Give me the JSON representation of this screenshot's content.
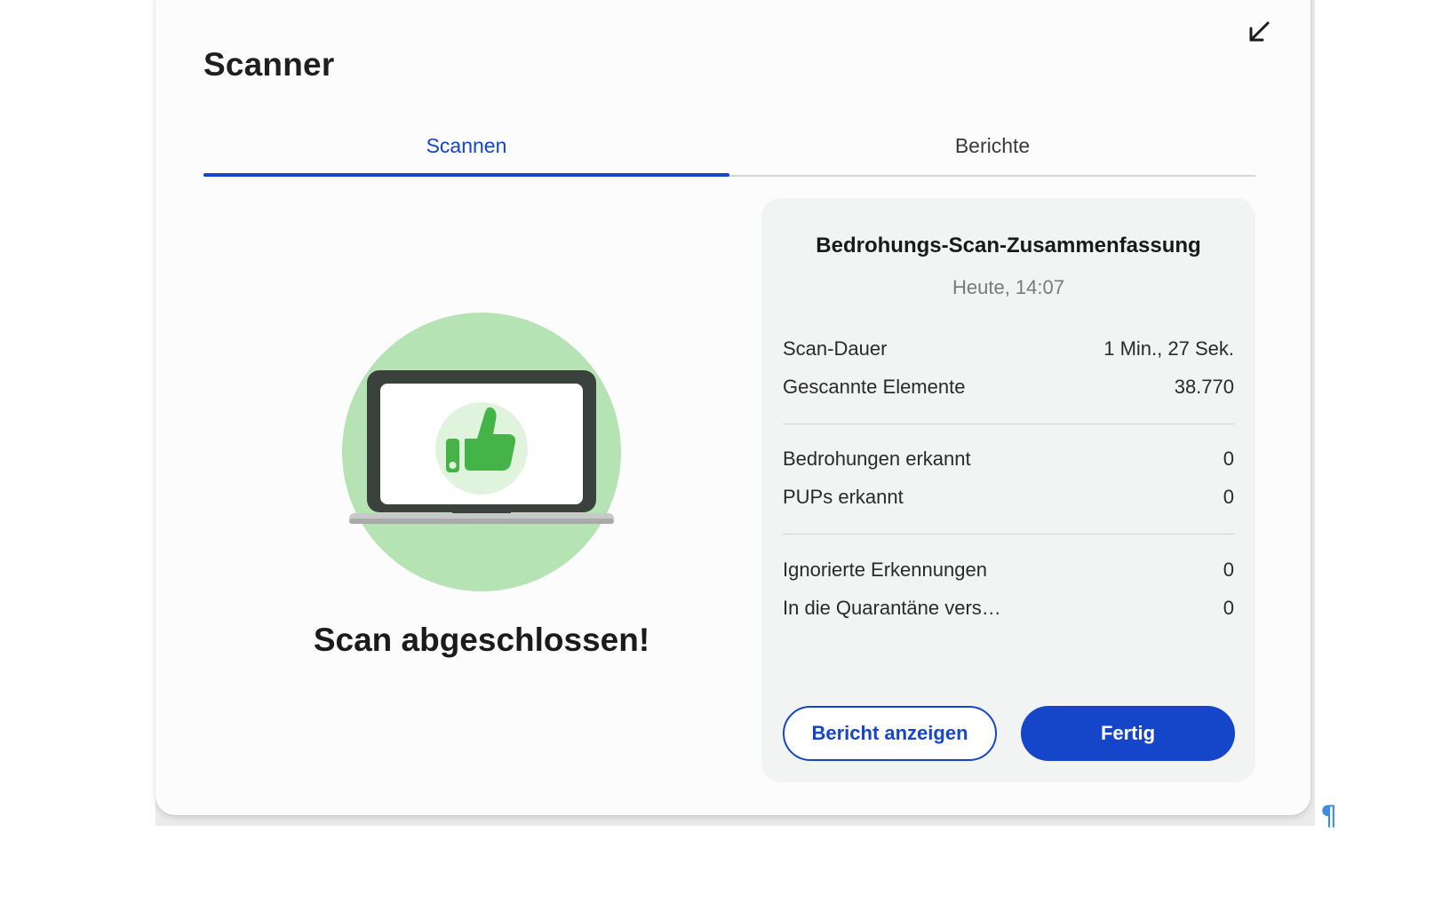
{
  "window": {
    "title": "Scanner",
    "minimize_icon": "arrow-down-left-icon"
  },
  "tabs": [
    {
      "label": "Scannen",
      "active": true
    },
    {
      "label": "Berichte",
      "active": false
    }
  ],
  "status": {
    "illustration": "laptop-thumbs-up-icon",
    "message": "Scan abgeschlossen!"
  },
  "summary": {
    "title": "Bedrohungs-Scan-Zusammenfassung",
    "date": "Heute, 14:07",
    "rows": [
      {
        "label": "Scan-Dauer",
        "value": "1 Min., 27 Sek."
      },
      {
        "label": "Gescannte Elemente",
        "value": "38.770"
      },
      {
        "label": "Bedrohungen erkannt",
        "value": "0"
      },
      {
        "label": "PUPs erkannt",
        "value": "0"
      },
      {
        "label": "Ignorierte Erkennungen",
        "value": "0"
      },
      {
        "label": "In die Quarantäne vers…",
        "value": "0"
      }
    ],
    "buttons": {
      "report": "Bericht anzeigen",
      "done": "Fertig"
    }
  },
  "misc": {
    "pilcrow": "¶"
  },
  "colors": {
    "accent": "#1545c8",
    "success_circle": "#b5e3b3",
    "thumb": "#44b449",
    "laptop_frame": "#3b423e"
  }
}
